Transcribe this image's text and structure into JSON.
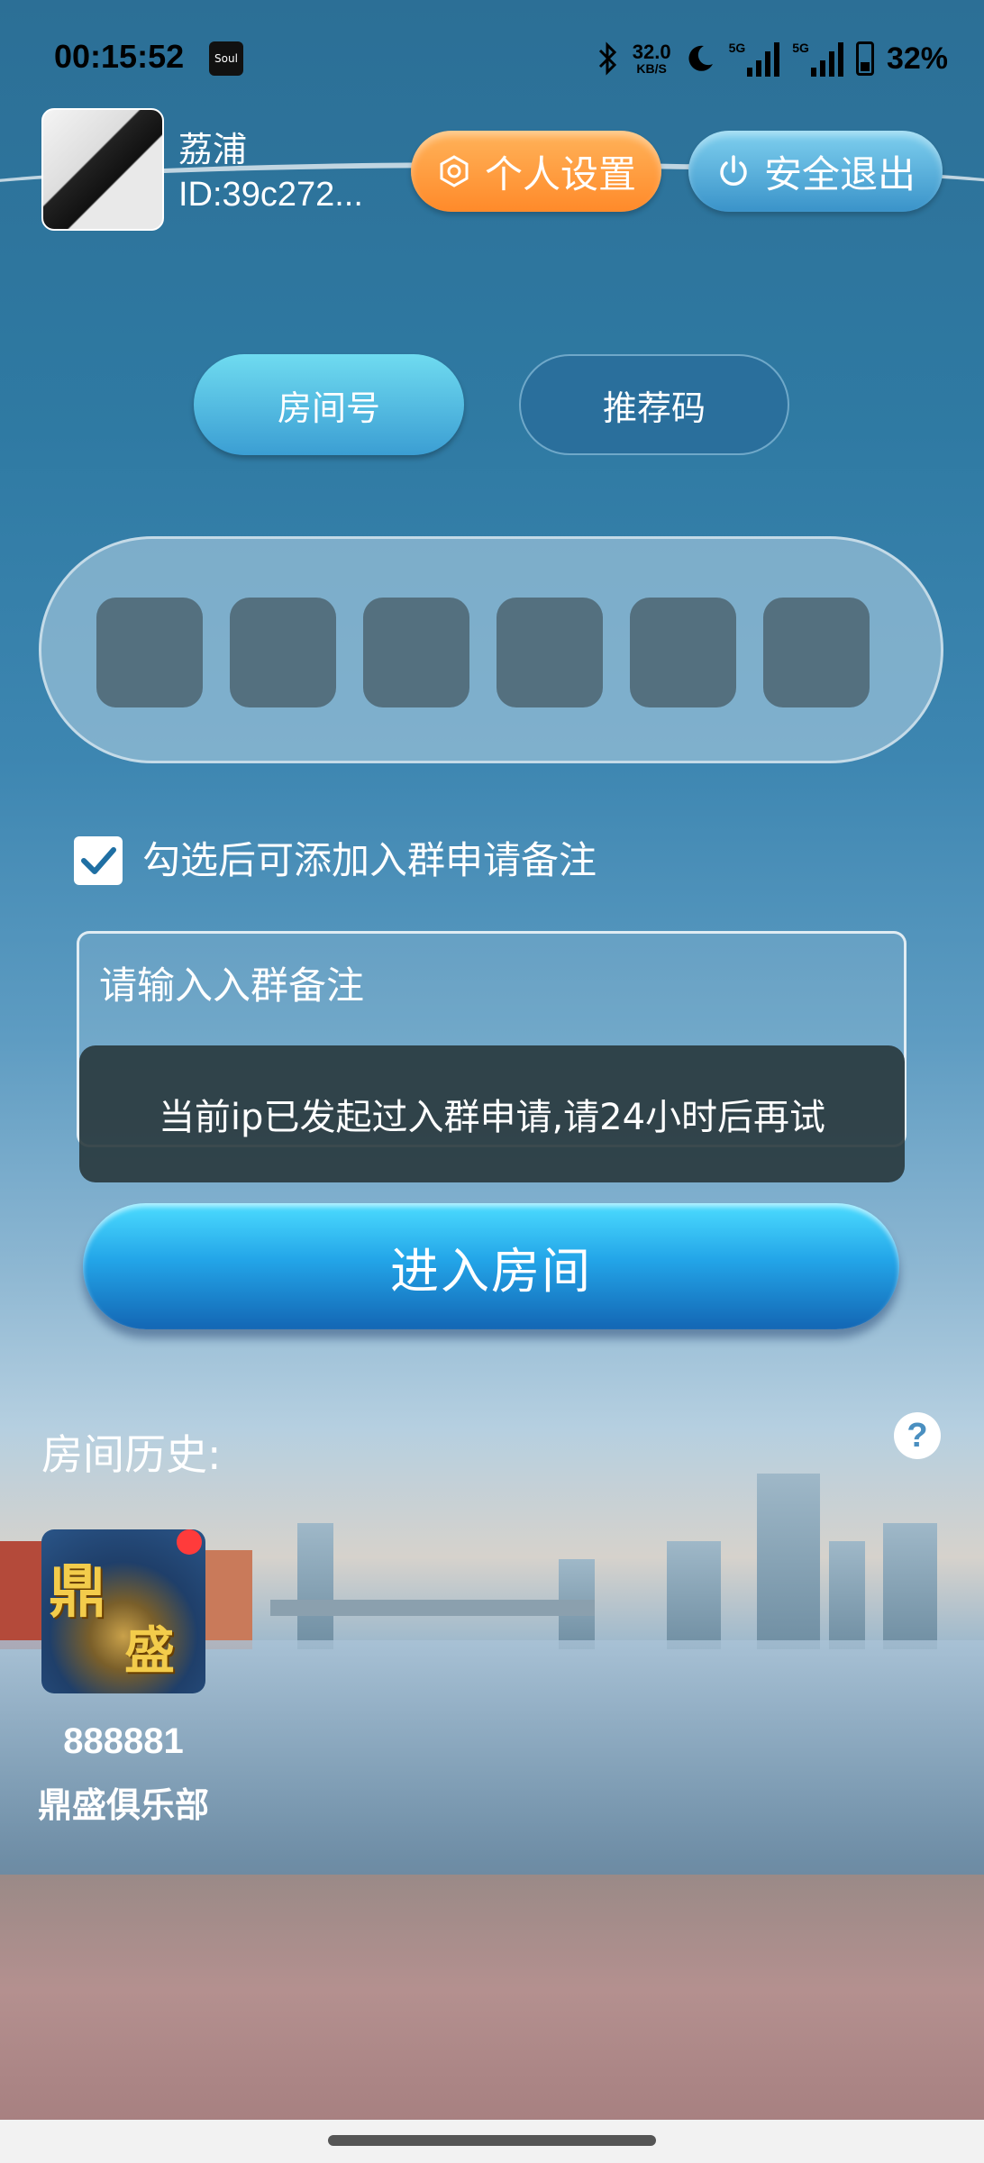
{
  "status_bar": {
    "time": "00:15:52",
    "app_icon_label": "Soul",
    "net_speed_value": "32.0",
    "net_speed_unit": "KB/S",
    "signal1_label": "5G",
    "signal2_label": "5G",
    "battery": "32%"
  },
  "user": {
    "name": "荔浦",
    "id": "ID:39c272..."
  },
  "header": {
    "settings_label": "个人设置",
    "logout_label": "安全退出"
  },
  "tabs": [
    {
      "label": "房间号",
      "active": true
    },
    {
      "label": "推荐码",
      "active": false
    }
  ],
  "code_input": {
    "digits": [
      "",
      "",
      "",
      "",
      "",
      ""
    ]
  },
  "checkbox": {
    "label": "勾选后可添加入群申请备注",
    "checked": true
  },
  "note_input": {
    "placeholder": "请输入入群备注",
    "value": ""
  },
  "toast": {
    "message": "当前ip已发起过入群申请,请24小时后再试"
  },
  "enter_button": {
    "label": "进入房间"
  },
  "history": {
    "title": "房间历史:",
    "help_symbol": "?",
    "rooms": [
      {
        "number": "888881",
        "name": "鼎盛俱乐部",
        "thumb_text1": "鼎",
        "thumb_text2": "盛"
      }
    ]
  },
  "colors": {
    "settings_button": "#ff8a2a",
    "logout_button": "#3a93c9",
    "enter_button": "#23a5e8",
    "badge_dot": "#ff3b3b"
  }
}
